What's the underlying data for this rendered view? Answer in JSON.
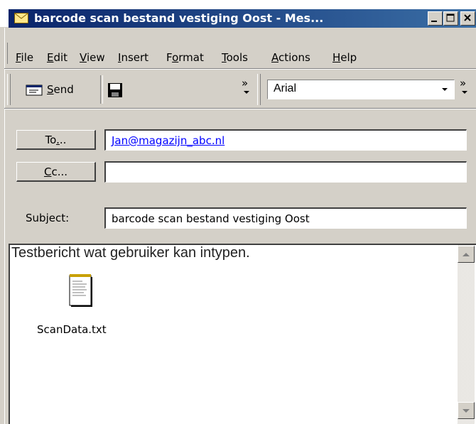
{
  "window": {
    "title": "barcode scan bestand vestiging Oost - Mes...",
    "colors": {
      "titlebar": "#0a246a",
      "face": "#d4d0c8",
      "link": "#0000ff"
    }
  },
  "menu": {
    "items": [
      {
        "label": "File",
        "accel": "F"
      },
      {
        "label": "Edit",
        "accel": "E"
      },
      {
        "label": "View",
        "accel": "V"
      },
      {
        "label": "Insert",
        "accel": "I"
      },
      {
        "label": "Format",
        "accel": "o"
      },
      {
        "label": "Tools",
        "accel": "T"
      },
      {
        "label": "Actions",
        "accel": "A"
      },
      {
        "label": "Help",
        "accel": "H"
      }
    ]
  },
  "toolbar": {
    "send_label": "Send",
    "font_name": "Arial",
    "overflow_glyph": "»"
  },
  "header": {
    "to_label": "To...",
    "cc_label": "Cc...",
    "subject_label": "Subject:",
    "to_value": "Jan@magazijn_abc.nl",
    "cc_value": "",
    "subject_value": "barcode scan bestand vestiging Oost"
  },
  "message": {
    "body_text": "Testbericht wat gebruiker kan intypen.",
    "attachment_name": "ScanData.txt"
  }
}
